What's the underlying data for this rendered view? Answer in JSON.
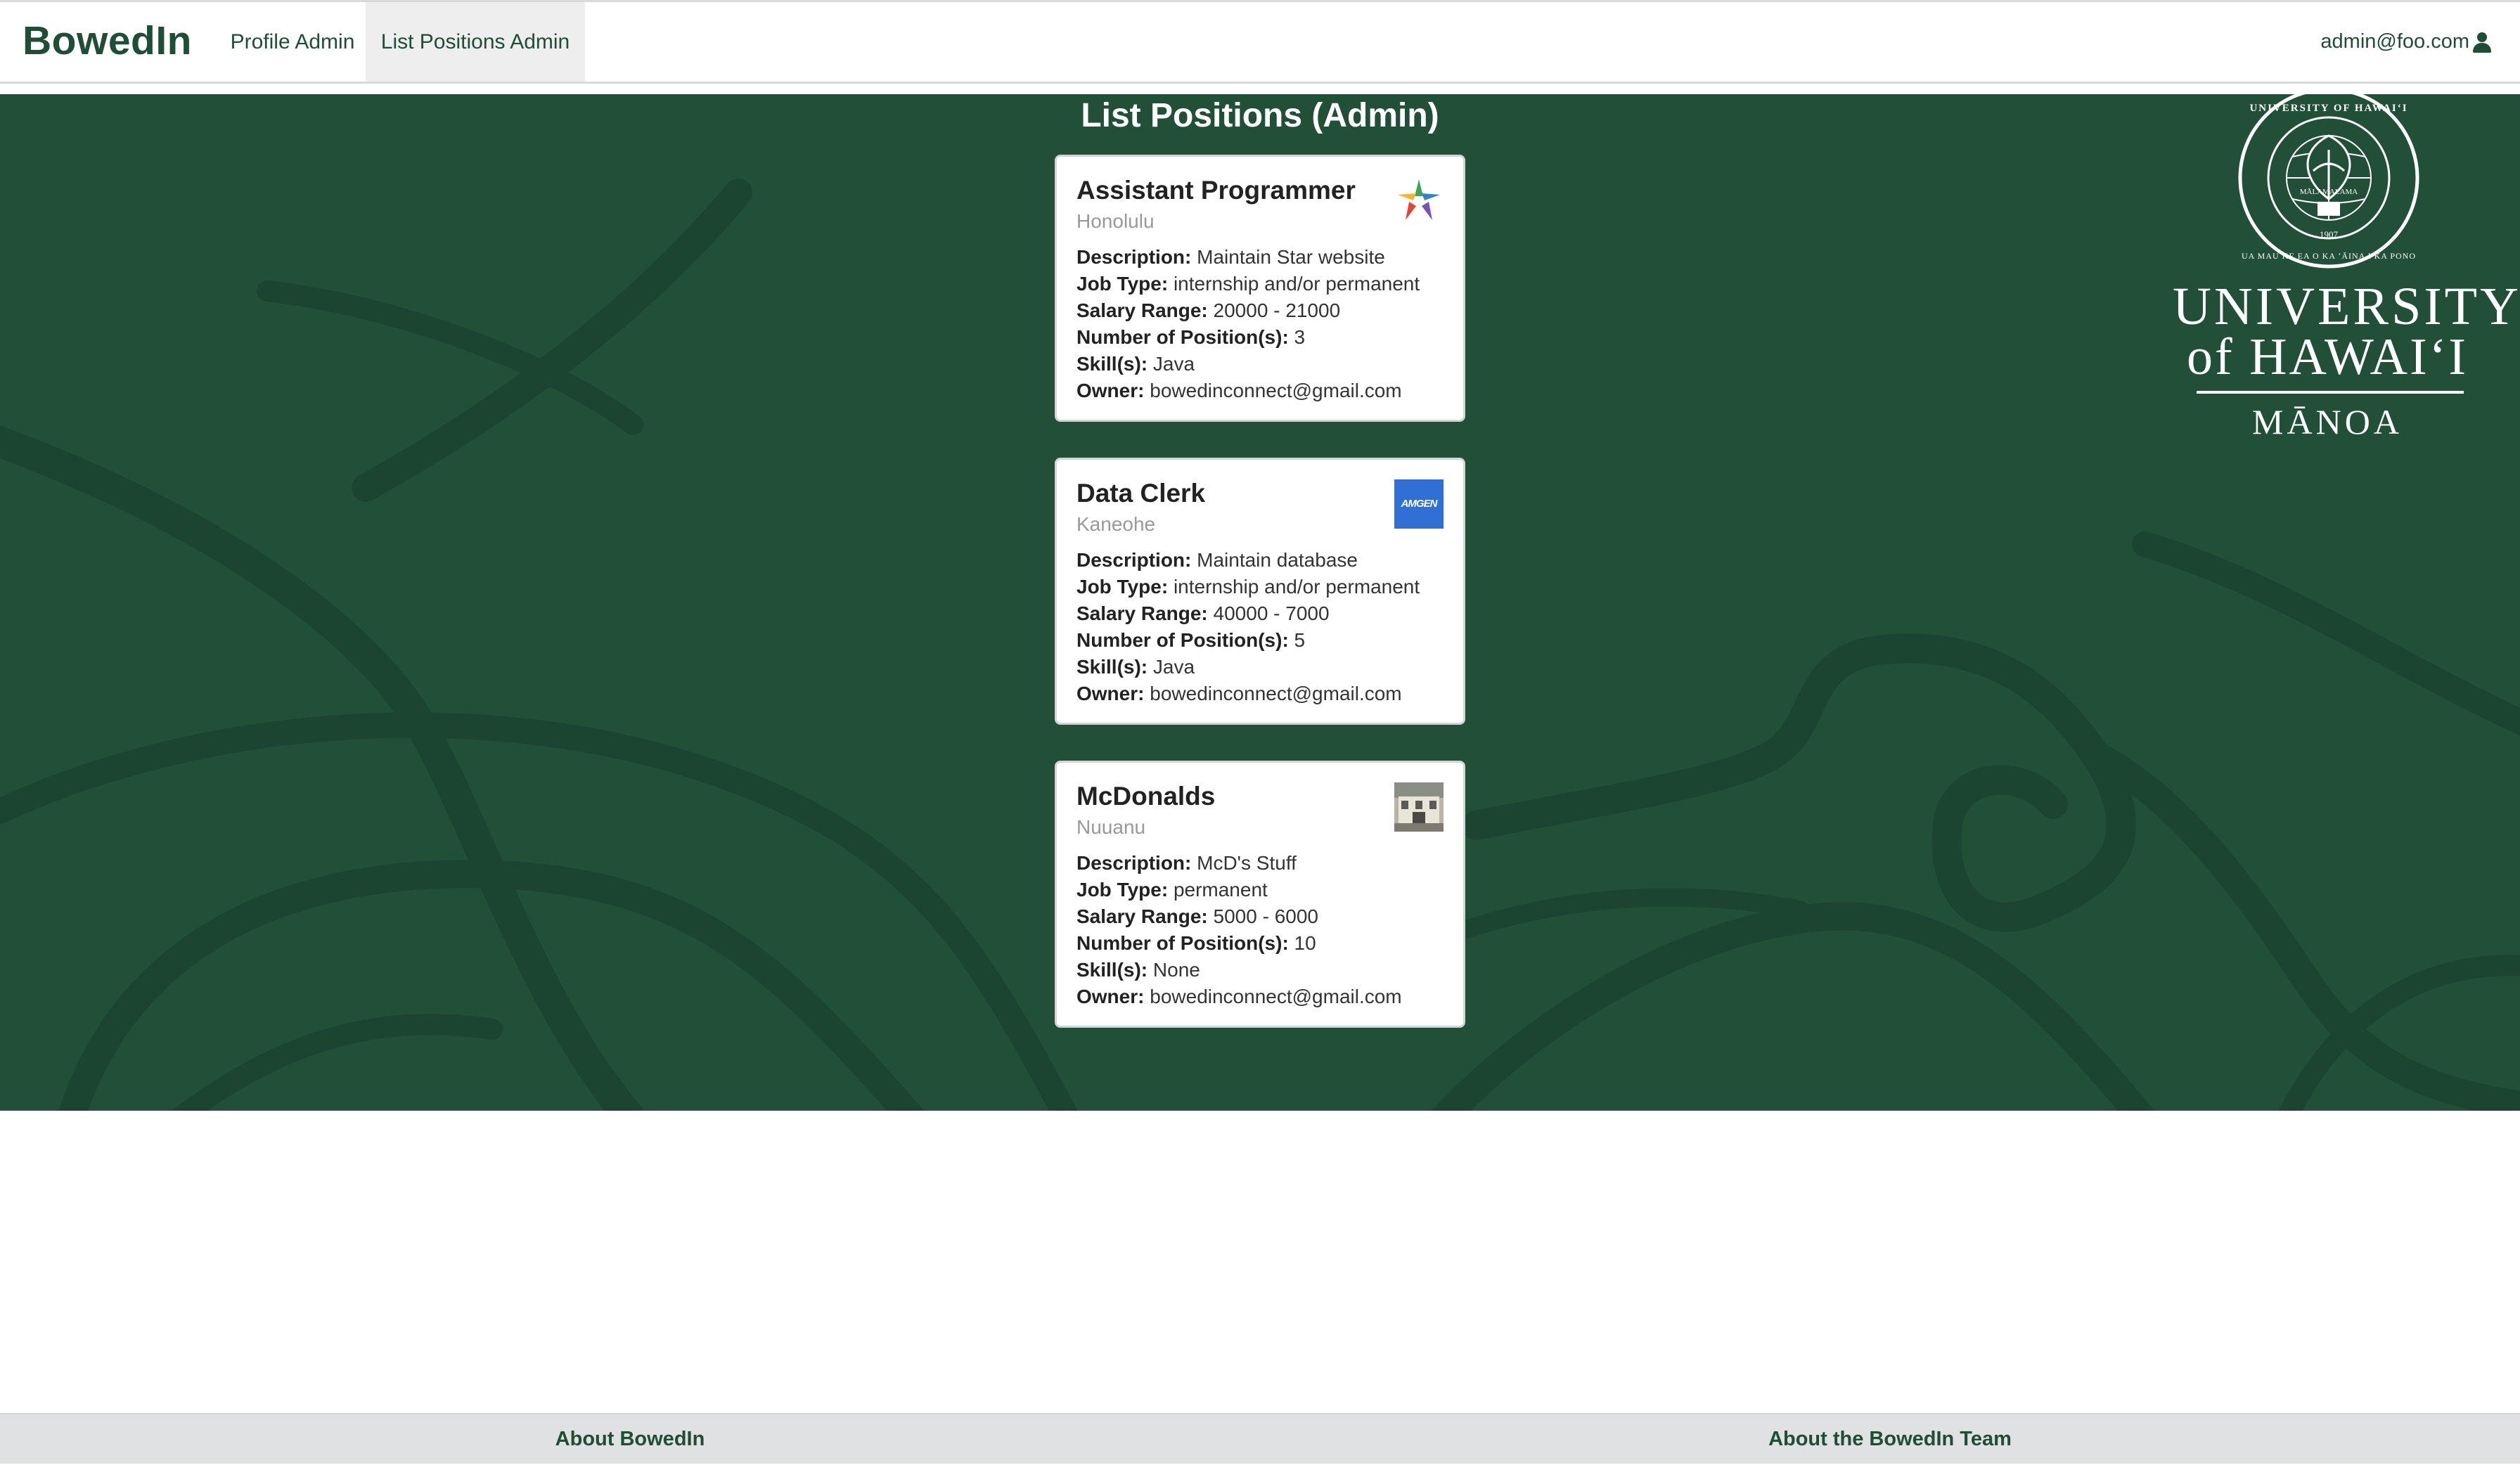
{
  "navbar": {
    "brand": "BowedIn",
    "items": [
      "Profile Admin",
      "List Positions Admin"
    ],
    "active_item": "List Positions Admin",
    "user_email": "admin@foo.com",
    "user_icon": "user-icon"
  },
  "main": {
    "title": "List Positions (Admin)",
    "labels": {
      "description": "Description:",
      "job_type": "Job Type:",
      "salary_range": "Salary Range:",
      "positions": "Number of Position(s):",
      "skills": "Skill(s):",
      "owner": "Owner:"
    },
    "cards": [
      {
        "title": "Assistant Programmer",
        "location": "Honolulu",
        "description": "Maintain Star website",
        "job_type": "internship and/or permanent",
        "salary_range": "20000 - 21000",
        "positions": "3",
        "skills": "Java",
        "owner": "bowedinconnect@gmail.com",
        "image": "star-logo"
      },
      {
        "title": "Data Clerk",
        "location": "Kaneohe",
        "description": "Maintain database",
        "job_type": "internship and/or permanent",
        "salary_range": "40000 - 7000",
        "positions": "5",
        "skills": "Java",
        "owner": "bowedinconnect@gmail.com",
        "image": "amgen-logo",
        "image_text": "AMGEN"
      },
      {
        "title": "McDonalds",
        "location": "Nuuanu",
        "description": "McD's Stuff",
        "job_type": "permanent",
        "salary_range": "5000 - 6000",
        "positions": "10",
        "skills": "None",
        "owner": "bowedinconnect@gmail.com",
        "image": "building-photo"
      }
    ]
  },
  "uh_logo": {
    "line1": "UNIVERSITY",
    "line2": "of HAWAI‘I",
    "line3": "MĀNOA",
    "seal_text": "UNIVERSITY OF HAWAI‘I",
    "seal_motto": "MĀLAMALAMA",
    "seal_year": "1907",
    "seal_bottom": "UA MAU KE EA O KA ‘ĀINA I KA PONO"
  },
  "footer": {
    "about": "About BowedIn",
    "team": "About the BowedIn Team"
  },
  "colors": {
    "brand_green": "#1f4e36",
    "background_green": "#214f37",
    "footer_gray": "#e0e1e2"
  }
}
